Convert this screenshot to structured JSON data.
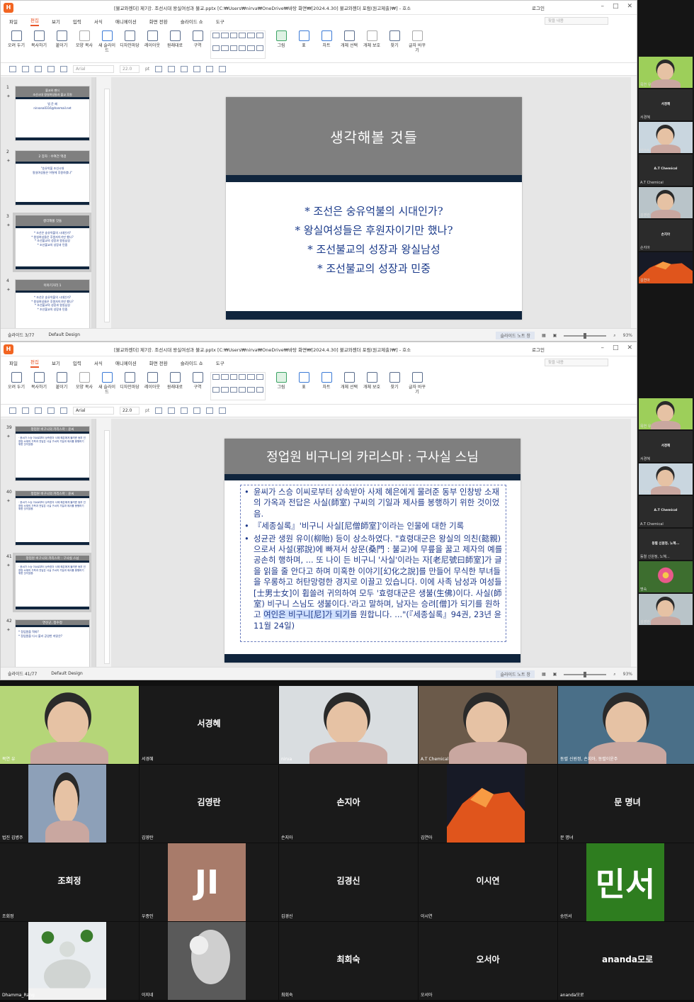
{
  "app": {
    "title1": "[불교와젠더] 제7강. 조선시대 왕실여성과 불교.pptx [C:₩Users₩nirva₩OneDrive₩바탕 화면₩[2024.4.30] 불교와젠더 포럼(원고제출)₩] - 호소",
    "title2": "[불교와젠더] 제7강. 조선시대 왕실여성과 불교.pptx [C:₩Users₩nirva₩OneDrive₩바탕 화면₩[2024.4.30] 불교와젠더 포럼(원고제출)₩] - 호소",
    "login": "로그인",
    "search_placeholder": "찾을 내용",
    "menus": [
      "파일",
      "편집",
      "보기",
      "입력",
      "서식",
      "애니메이션",
      "화면 전환",
      "슬라이드 쇼",
      "도구"
    ],
    "ribbon": [
      "오려 두기",
      "복사하기",
      "붙이기",
      "모양 복사",
      "새 슬라이드",
      "디자인마당",
      "레이아웃",
      "원래대로",
      "구역",
      "그림",
      "표",
      "차트",
      "개체 선택",
      "개체 보호",
      "찾기",
      "글자 바꾸기"
    ],
    "font1": "Arial",
    "font2": "Arial",
    "size1": "22.0",
    "size2": "22.0",
    "unit": "pt",
    "ruler1": "|·12·|·11·|·10·|·9·|·8·|·7·|·6·|·5·|·4·|·3·|·2·|·1·|·0·|·1·|·2·|·3·|·4·|·5·|·6·|·7·|·8·|·9·|·10·|·11·|·12·|",
    "ruler2": "|·1·|·2·|·3·|·4·|·5·|·6·|·7·|·8·|·9·|·10·|·11·|·12·|·13·|·14·|·15·|·16·|·17·|·18·|·19·|·20·|·21·|·22·|·23·|"
  },
  "window1": {
    "status_slide": "슬라이드 3/77",
    "status_design": "Default Design",
    "note_btn": "슬라이드 노트 창",
    "zoom": "93%",
    "thumbs": [
      {
        "num": "1",
        "head": "불교와 젠더\n조선시대 왕실여성들과 불교 후원",
        "body": "법 운 혜\nnirvana0316@hanmail.net"
      },
      {
        "num": "2",
        "head": "2 장차 : 수여건 맥검",
        "body": "\"승유억불 조선시대\n왕실여성들은 어떻게 후원하였나\""
      },
      {
        "num": "3",
        "head": "생각해볼 것들",
        "body": "* 조선은 숭유억불의 시대인가?\n* 왕실여성들은 후원자이기만 했나?\n* 조선불교의 성장과 왕실남성\n* 조선불교의 성장과 민중"
      },
      {
        "num": "4",
        "head": "이야기거리 1",
        "body": "* 조선은 숭유억불의 시대인가?\n* 왕실여성들은 후원자이기만 했나?\n* 조선불교의 성장과 왕실남성\n* 조선불교의 성장과 민중"
      }
    ],
    "slide_title": "생각해볼 것들",
    "slide_lines": [
      "* 조선은 숭유억불의 시대인가?",
      "* 왕실여성들은 후원자이기만 했나?",
      "* 조선불교의 성장과 왕실남성",
      "* 조선불교의 성장과 민중"
    ]
  },
  "window2": {
    "status_slide": "슬라이드 41/77",
    "status_design": "Default Design",
    "note_btn": "슬라이드 노트 창",
    "zoom": "93%",
    "thumbs": [
      {
        "num": "39",
        "head": "정업원 비구니의 카리스마 : 윤씨",
        "body": "· 윤씨가 스승 이씨로부터 상속받아 사제 혜은에게 물려준 동부 인창방 소재의 가옥과 전답은 사실 구씨의 기일과 제사를 봉행하기 위한 것이었음."
      },
      {
        "num": "40",
        "head": "정업원 비구니의 카리스마 : 윤씨",
        "body": "· 윤씨가 스승 이씨로부터 상속받아 사제 혜은에게 물려준 동부 인창방 소재의 가옥과 전답은 사실 구씨의 기일과 제사를 봉행하기 위한 것이었음."
      },
      {
        "num": "41",
        "head": "정업원 비구니의 카리스마 : 구사실 스님",
        "body": "· 윤씨가 스승 이씨로부터 상속받아 사제 혜은에게 물려준 동부 인창방 소재의 가옥과 전답은 사실 구씨의 기일과 제사를 봉행하기 위한 것이었음."
      },
      {
        "num": "42",
        "head": "연산군, 정수정",
        "body": "* 정업원을 혁파?\n* 정업원을 다시 불러 공양한 까닭은?"
      }
    ],
    "slide_title": "정업원 비구니의 카리스마 : 구사실 스님",
    "para1": "윤씨가 스승 이씨로부터 상속받아 사제 혜은에게 물려준 동부 인창방 소재의 가옥과 전답은 사실(師室) 구씨의 기일과 제사를 봉행하기 위한 것이었음.",
    "para2": "『세종실록』'비구니 사실[尼僧師室]'이라는 인물에 대한 기록",
    "para3a": "성균관 생원 유이(柳貽) 등이 상소하였다. \"효령대군은 왕실의 의친(懿親)으로서 사설(邪說)에 빠져서 상문(桑門 : 불교)에 무릎을 꿇고 제자의 예를 공손히 행하며, ... 또 나이 든 비구니 '사실'이라는 자[老尼號曰師室]가 글을 읽을 줄 안다고 하며 미혹한 이야기[幻化之說]를 만들어 무식한 부녀들을 우롱하고 허탄망령한 경지로 이끌고 있습니다. 이에 사족 남성과 여성들[士男士女]이 휩쓸려 귀의하여 모두 '효령대군은 생불(生佛)이다. 사실(師室) 비구니 스님도 생불이다.'라고 말하며, 남자는 승려[僧]가 되기를 원하고 ",
    "para3hl": "여인은 비구니[尼]가 되기",
    "para3b": "를 원합니다. ...\"(『세종실록』94권, 23년 윤11월 24일)"
  },
  "side1": [
    {
      "label": "목연 유",
      "kind": "face",
      "bg": "#9dcf5a"
    },
    {
      "label": "서경혜",
      "kind": "name"
    },
    {
      "label": "nirva",
      "kind": "face",
      "bg": "#c9d6df"
    },
    {
      "label": "A.T Chemical",
      "kind": "name"
    },
    {
      "label": "김영란",
      "kind": "face",
      "bg": "#b9c4c9"
    },
    {
      "label": "손지아",
      "kind": "name"
    },
    {
      "label": "김연아",
      "kind": "mountain"
    }
  ],
  "side2": [
    {
      "label": "목연 유",
      "kind": "face",
      "bg": "#9dcf5a"
    },
    {
      "label": "서경혜",
      "kind": "name"
    },
    {
      "label": "nirva",
      "kind": "face",
      "bg": "#c9d6df"
    },
    {
      "label": "A.T Chemical",
      "kind": "name"
    },
    {
      "label": "동렬 신원정, 노혜...",
      "kind": "name"
    },
    {
      "label": "명숙",
      "kind": "flower"
    },
    {
      "label": "김영란",
      "kind": "face",
      "bg": "#b9c4c9"
    }
  ],
  "gallery": [
    {
      "cap": "목연 유",
      "name": "",
      "kind": "face",
      "bg": "#b5d678"
    },
    {
      "cap": "서경혜",
      "name": "서경혜",
      "kind": "name"
    },
    {
      "cap": "nirva",
      "name": "",
      "kind": "face",
      "bg": "#d9dde0"
    },
    {
      "cap": "A.T Chemical",
      "name": "",
      "kind": "face",
      "bg": "#6b5a4a"
    },
    {
      "cap": "동렬 신원정, 손지아, 동렬이윤주",
      "name": "",
      "kind": "face",
      "bg": "#4a6f88"
    },
    {
      "cap": "법진 김병주",
      "name": "",
      "kind": "face",
      "bg": "#8da0b8"
    },
    {
      "cap": "김영란",
      "name": "김영란",
      "kind": "name"
    },
    {
      "cap": "손지아",
      "name": "손지아",
      "kind": "name"
    },
    {
      "cap": "김연아",
      "name": "",
      "kind": "mountain"
    },
    {
      "cap": "문 명녀",
      "name": "문 명녀",
      "kind": "name"
    },
    {
      "cap": "조회정",
      "name": "조회정",
      "kind": "name"
    },
    {
      "cap": "우종인",
      "name": "JI",
      "kind": "initials",
      "bg": "#a87b6a"
    },
    {
      "cap": "김경신",
      "name": "김경신",
      "kind": "name"
    },
    {
      "cap": "이시연",
      "name": "이시연",
      "kind": "name"
    },
    {
      "cap": "송민서",
      "name": "민서",
      "kind": "initials",
      "bg": "#2e7d1f"
    },
    {
      "cap": "Dhamma_Rang",
      "name": "",
      "kind": "statue"
    },
    {
      "cap": "이지네",
      "name": "",
      "kind": "bw"
    },
    {
      "cap": "최회숙",
      "name": "최회숙",
      "kind": "name"
    },
    {
      "cap": "오서아",
      "name": "오서아",
      "kind": "name"
    },
    {
      "cap": "ananda모로",
      "name": "ananda모로",
      "kind": "name"
    }
  ]
}
